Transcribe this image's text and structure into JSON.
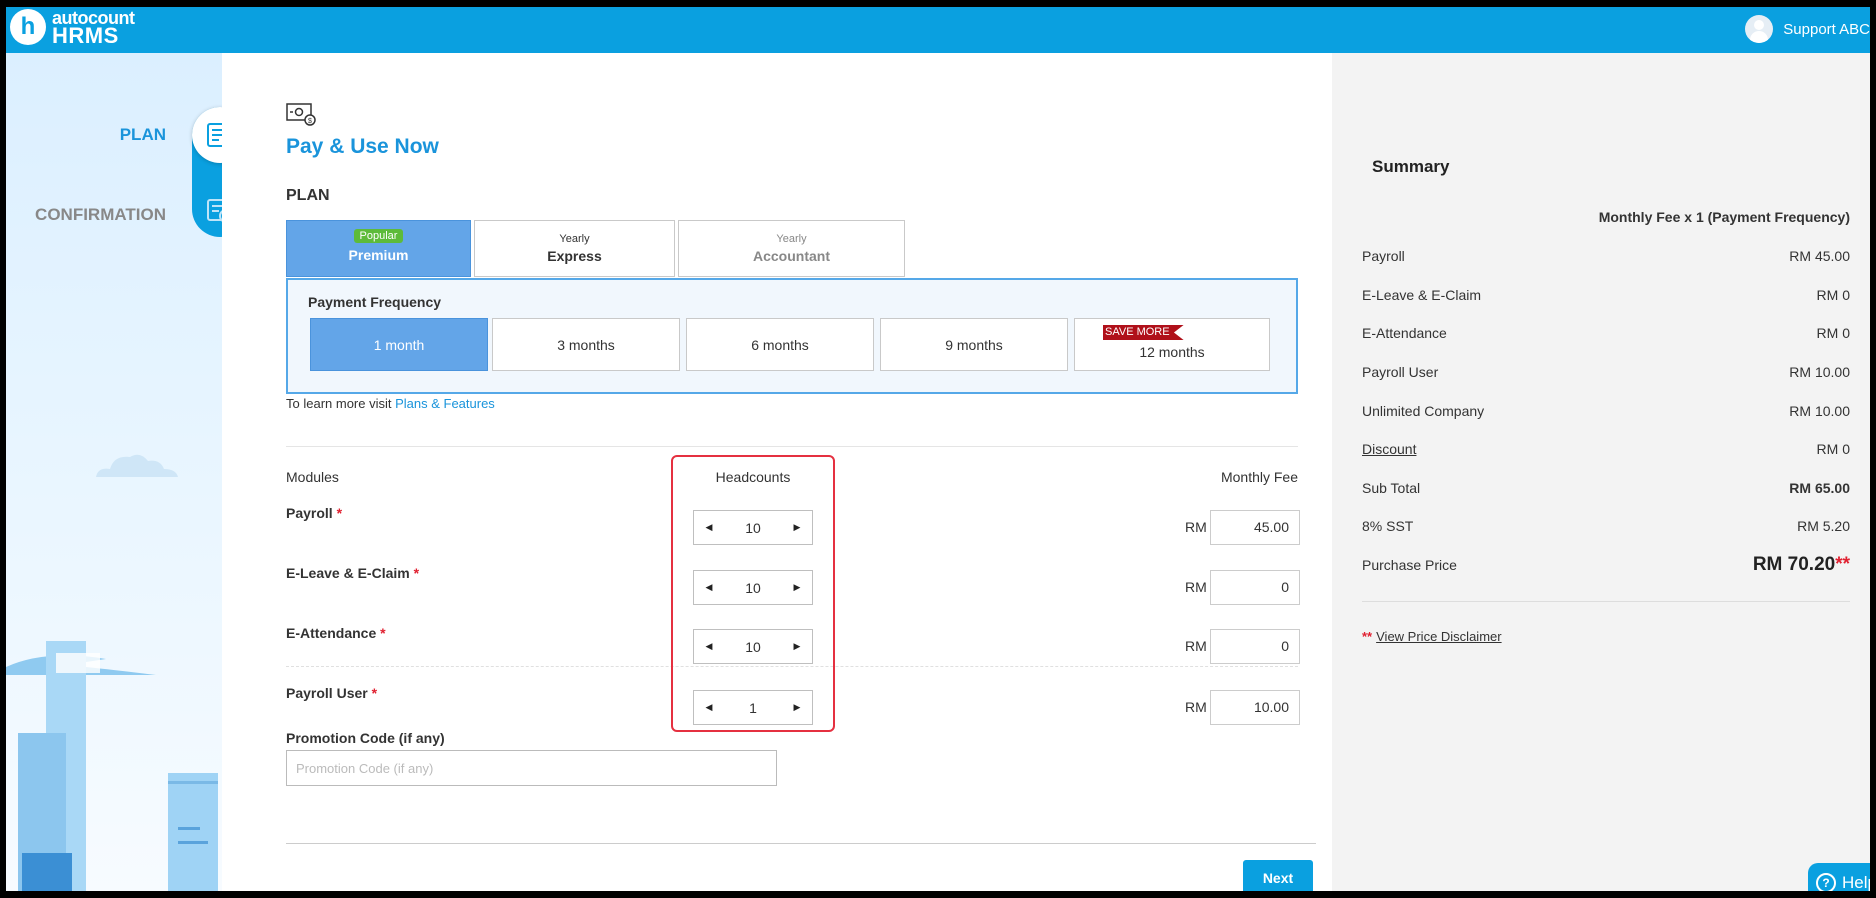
{
  "header": {
    "logo_mark": "h",
    "logo_top": "autocount",
    "logo_bottom": "HRMS",
    "user_name": "Support ABC"
  },
  "steps": {
    "plan": "PLAN",
    "confirmation": "CONFIRMATION"
  },
  "main": {
    "title": "Pay & Use Now",
    "plan_heading": "PLAN",
    "plans": [
      {
        "small": "Popular",
        "label": "Premium"
      },
      {
        "small": "Yearly",
        "label": "Express"
      },
      {
        "small": "Yearly",
        "label": "Accountant"
      }
    ],
    "selected_plan": "Premium",
    "payment_frequency_label": "Payment Frequency",
    "frequencies": [
      "1 month",
      "3 months",
      "6 months",
      "9 months",
      "12 months"
    ],
    "selected_frequency": "1 month",
    "save_more_badge": "SAVE MORE",
    "learn_more_text": "To learn more visit ",
    "learn_more_link": "Plans & Features",
    "modules_header": "Modules",
    "headcounts_header": "Headcounts",
    "monthly_fee_header": "Monthly Fee",
    "currency": "RM",
    "modules": [
      {
        "name": "Payroll",
        "headcount": "10",
        "fee": "45.00"
      },
      {
        "name": "E-Leave & E-Claim",
        "headcount": "10",
        "fee": "0"
      },
      {
        "name": "E-Attendance",
        "headcount": "10",
        "fee": "0"
      },
      {
        "name": "Payroll User",
        "headcount": "1",
        "fee": "10.00"
      }
    ],
    "required_mark": "*",
    "promo_label": "Promotion Code (if any)",
    "promo_placeholder": "Promotion Code (if any)",
    "promo_value": "",
    "next_label": "Next"
  },
  "summary": {
    "title": "Summary",
    "fee_header": "Monthly Fee x 1 (Payment Frequency)",
    "rows": [
      {
        "label": "Payroll",
        "value": "RM 45.00"
      },
      {
        "label": "E-Leave & E-Claim",
        "value": "RM 0"
      },
      {
        "label": "E-Attendance",
        "value": "RM 0"
      },
      {
        "label": "Payroll User",
        "value": "RM 10.00"
      },
      {
        "label": "Unlimited Company",
        "value": "RM 10.00"
      },
      {
        "label": "Discount",
        "value": "RM 0"
      },
      {
        "label": "Sub Total",
        "value": "RM 65.00"
      },
      {
        "label": "8% SST",
        "value": "RM 5.20"
      },
      {
        "label": "Purchase Price",
        "value": "RM 70.20"
      }
    ],
    "price_stars": "**",
    "disclaimer_stars": "**",
    "disclaimer_link": "View Price Disclaimer"
  },
  "help_label": "Help",
  "colors": {
    "brand": "#0aa0e0",
    "selected": "#63a5e8",
    "popular_badge": "#5dbb3a",
    "required": "#e02030",
    "highlight_frame": "#e53040",
    "save_ribbon": "#b0101a"
  },
  "icons": {
    "logo": "hrms-logo-icon",
    "avatar": "user-avatar-icon",
    "plan_step": "plan-form-icon",
    "confirmation_step": "confirmation-check-icon",
    "pay": "money-bill-icon",
    "decrement": "caret-left-icon",
    "increment": "caret-right-icon",
    "help": "question-circle-icon"
  }
}
